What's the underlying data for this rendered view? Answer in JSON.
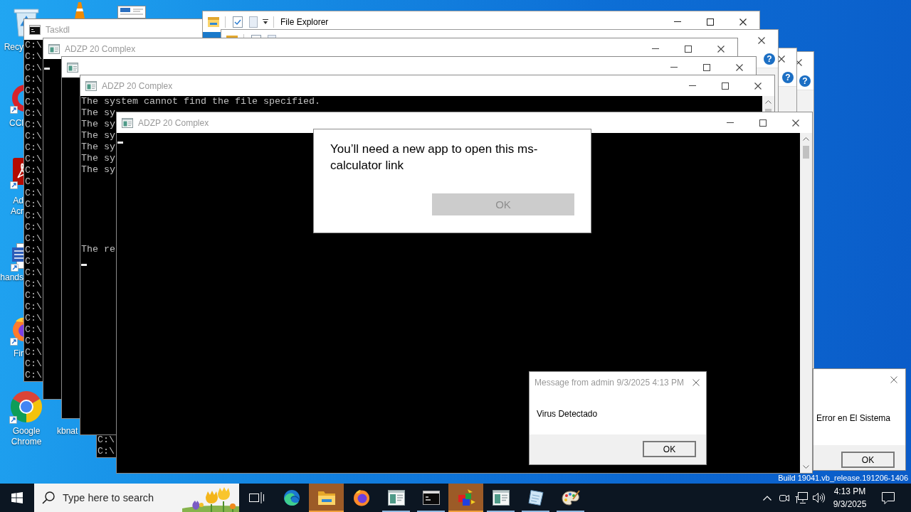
{
  "desktop": {
    "icons": [
      {
        "label": "Recy"
      },
      {
        "label": "CCl"
      },
      {
        "label": "Ad Acr"
      },
      {
        "label": "hands"
      },
      {
        "label": "Fir"
      },
      {
        "label": "Google Chrome"
      },
      {
        "label": "kbnat"
      }
    ],
    "build_text": "Build 19041.vb_release.191206-1406"
  },
  "windows": [
    {
      "kind": "explorer",
      "help_button": "?"
    },
    {
      "kind": "explorer",
      "help_button": "?"
    },
    {
      "kind": "console",
      "title": "Taskdl",
      "active": false,
      "lines": [
        "C:\\",
        "C:\\",
        "C:\\",
        "C:\\",
        "C:\\",
        "C:\\",
        "C:\\",
        "C:\\",
        "C:\\",
        "C:\\",
        "C:\\",
        "C:\\",
        "C:\\",
        "C:\\",
        "C:\\",
        "C:\\",
        "C:\\",
        "C:\\",
        "C:\\",
        "C:\\",
        "C:\\",
        "C:\\",
        "C:\\",
        "C:\\",
        "C:\\",
        "C:\\",
        "C:\\",
        "C:\\",
        "C:\\",
        "C:\\"
      ],
      "cursor": false
    },
    {
      "kind": "explorer",
      "title": "File Explorer",
      "active": true
    },
    {
      "kind": "explorer",
      "help_button": "?"
    },
    {
      "kind": "console",
      "title": "ADZP 20 Complex",
      "active": false,
      "cursor": true
    },
    {
      "kind": "console",
      "cursor": false
    },
    {
      "kind": "console",
      "title": "ADZP 20 Complex",
      "active": false,
      "lines": [
        "The system cannot find the file specified.",
        "The sy",
        "The sy",
        "The sy",
        "The sy",
        "The sy",
        "The sy"
      ],
      "last_line": "The re",
      "cursor": true
    },
    {
      "kind": "console",
      "lines": [
        "C:\\",
        "C:\\"
      ],
      "cursor": false
    },
    {
      "kind": "console",
      "title": "ADZP 20 Complex",
      "active": false,
      "cursor": true
    },
    {
      "kind": "app_prompt",
      "message": "You’ll need a new app to open this ms-calculator link",
      "button": {
        "label": "OK",
        "disabled": true
      }
    },
    {
      "kind": "message",
      "title": "Message from admin 9/3/2025 4:13 PM",
      "active": false,
      "message": "Virus Detectado",
      "button": {
        "label": "OK"
      }
    },
    {
      "kind": "message",
      "message": "Error en El Sistema",
      "button": {
        "label": "OK"
      }
    }
  ],
  "taskbar": {
    "search": {
      "placeholder": "Type here to search"
    },
    "apps": [
      {
        "running": false,
        "flashing": false
      },
      {
        "running": true,
        "flashing": true
      },
      {
        "running": false,
        "flashing": false
      },
      {
        "running": true,
        "flashing": false
      },
      {
        "running": true,
        "flashing": false
      },
      {
        "running": true,
        "flashing": true
      },
      {
        "running": true,
        "flashing": false
      },
      {
        "running": true,
        "flashing": false
      },
      {
        "running": true,
        "flashing": false
      }
    ],
    "clock": {
      "time": "4:13 PM",
      "date": "9/3/2025"
    }
  }
}
